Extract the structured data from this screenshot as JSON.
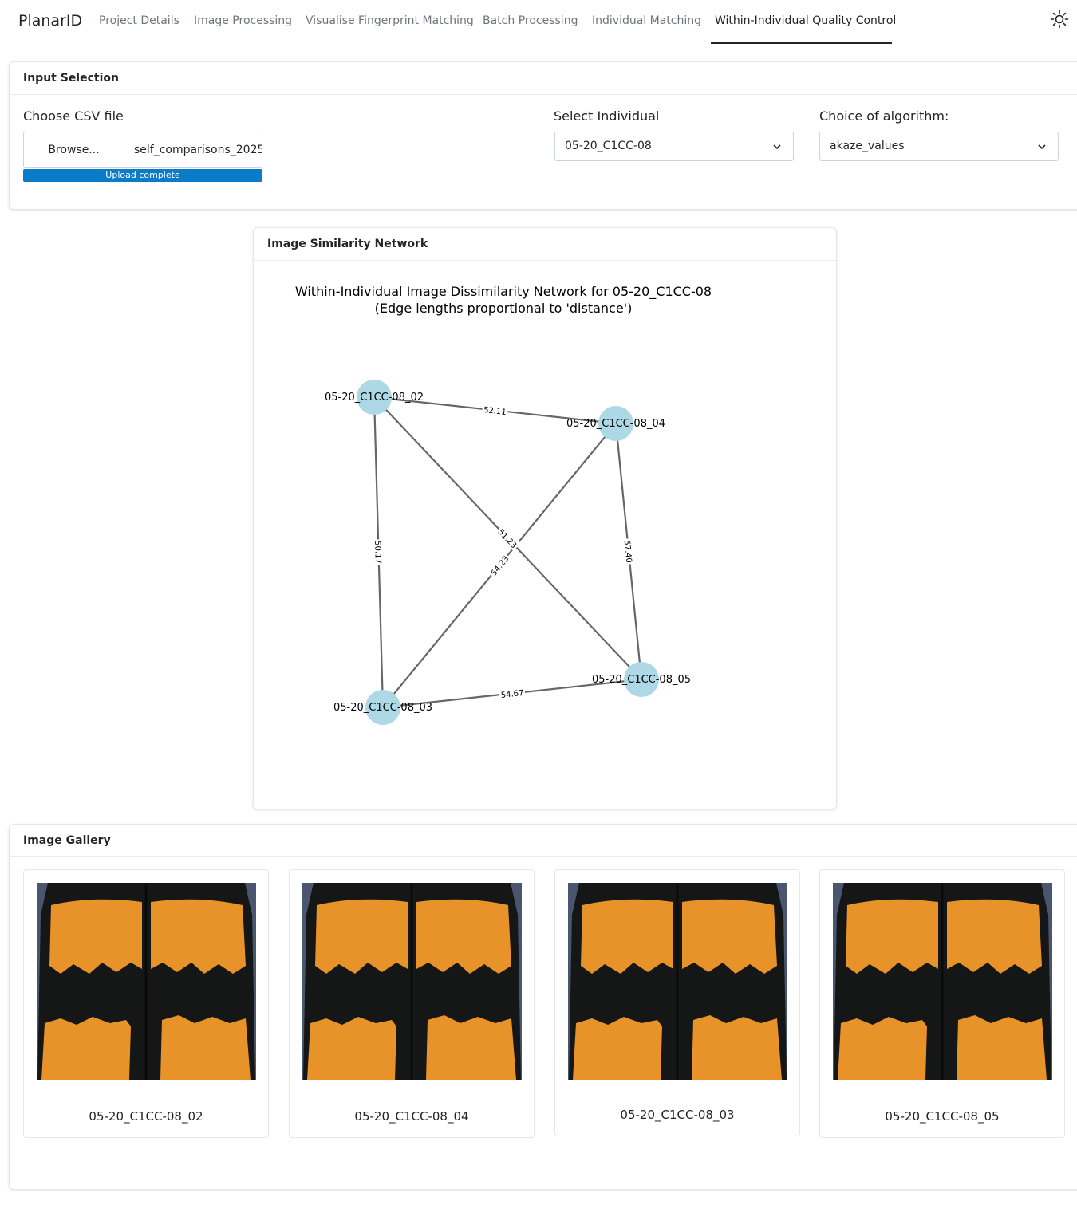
{
  "navbar": {
    "brand": "PlanarID",
    "tabs": [
      {
        "label": "Project Details"
      },
      {
        "label": "Image Processing"
      },
      {
        "label": "Visualise Fingerprint Matching"
      },
      {
        "label": "Batch Processing"
      },
      {
        "label": "Individual Matching"
      },
      {
        "label": "Within-Individual Quality Control"
      }
    ],
    "active_tab": "Within-Individual Quality Control",
    "theme_icon": "sun-icon"
  },
  "input_selection": {
    "title": "Input Selection",
    "csv_label": "Choose CSV file",
    "browse_label": "Browse...",
    "file_name": "self_comparisons_2025",
    "progress_label": "Upload complete",
    "progress_value": 1.0,
    "individual_label": "Select Individual",
    "individual_value": "05-20_C1CC-08",
    "algorithm_label": "Choice of algorithm:",
    "algorithm_value": "akaze_values"
  },
  "network": {
    "title": "Image Similarity Network",
    "chart_data": {
      "type": "network",
      "title_line1": "Within-Individual Image Dissimilarity Network for 05-20_C1CC-08",
      "title_line2": "(Edge lengths proportional to 'distance')",
      "nodes": [
        "05-20_C1CC-08_02",
        "05-20_C1CC-08_04",
        "05-20_C1CC-08_03",
        "05-20_C1CC-08_05"
      ],
      "edges": [
        {
          "source": "05-20_C1CC-08_02",
          "target": "05-20_C1CC-08_04",
          "distance": "52.11"
        },
        {
          "source": "05-20_C1CC-08_02",
          "target": "05-20_C1CC-08_03",
          "distance": "50.17"
        },
        {
          "source": "05-20_C1CC-08_02",
          "target": "05-20_C1CC-08_05",
          "distance": "51.23"
        },
        {
          "source": "05-20_C1CC-08_04",
          "target": "05-20_C1CC-08_03",
          "distance": "54.23"
        },
        {
          "source": "05-20_C1CC-08_04",
          "target": "05-20_C1CC-08_05",
          "distance": "57.40"
        },
        {
          "source": "05-20_C1CC-08_03",
          "target": "05-20_C1CC-08_05",
          "distance": "54.67"
        }
      ],
      "node_color": "#add8e6",
      "edge_color": "#666666"
    }
  },
  "gallery": {
    "title": "Image Gallery",
    "items": [
      {
        "caption": "05-20_C1CC-08_02"
      },
      {
        "caption": "05-20_C1CC-08_04"
      },
      {
        "caption": "05-20_C1CC-08_03"
      },
      {
        "caption": "05-20_C1CC-08_05"
      }
    ],
    "colors": {
      "orange": "#e8922a",
      "black": "#151616",
      "background": "#4a5570"
    }
  },
  "colors": {
    "progress": "#0a7bc7",
    "text": "#212529",
    "muted": "#6c757d"
  }
}
